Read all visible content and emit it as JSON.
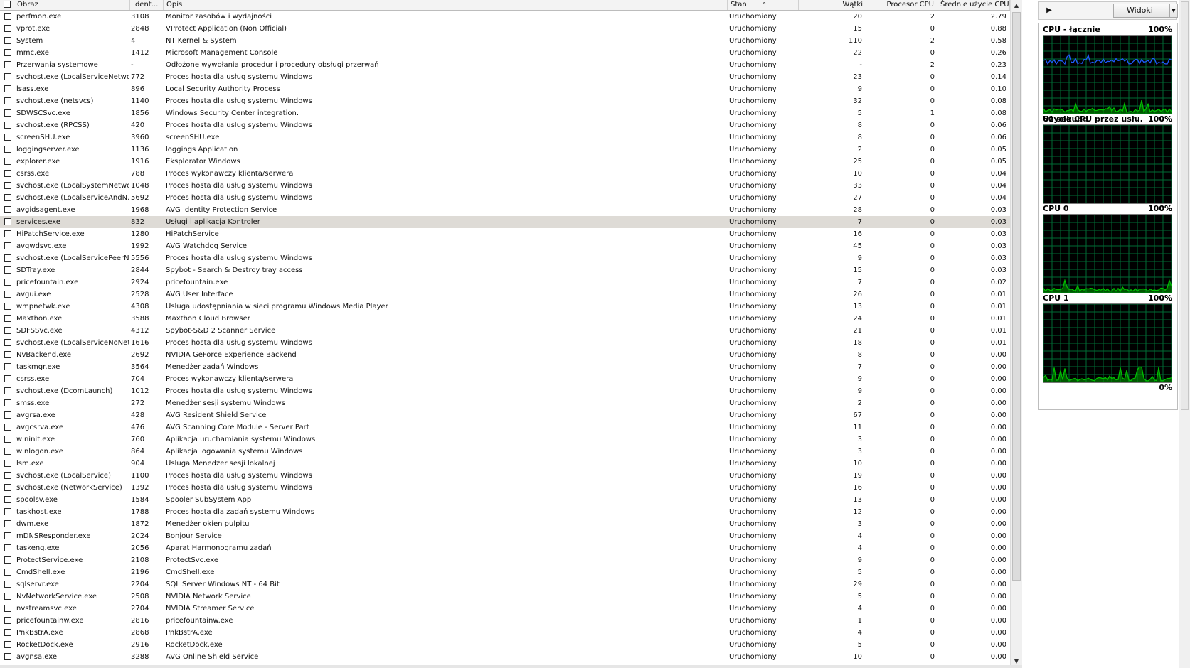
{
  "columns": {
    "name": "Obraz",
    "pid": "Ident...",
    "desc": "Opis",
    "stan": "Stan",
    "stan_sort": "^",
    "watki": "Wątki",
    "cpu": "Procesor CPU",
    "avg": "Średnie użycie CPU"
  },
  "selected_index": 17,
  "rows": [
    [
      "perfmon.exe",
      "3108",
      "Monitor zasobów i wydajności",
      "Uruchomiony",
      "20",
      "2",
      "2.79"
    ],
    [
      "vprot.exe",
      "2848",
      "VProtect Application (Non Official)",
      "Uruchomiony",
      "15",
      "0",
      "0.88"
    ],
    [
      "System",
      "4",
      "NT Kernel & System",
      "Uruchomiony",
      "110",
      "2",
      "0.58"
    ],
    [
      "mmc.exe",
      "1412",
      "Microsoft Management Console",
      "Uruchomiony",
      "22",
      "0",
      "0.26"
    ],
    [
      "Przerwania systemowe",
      "-",
      "Odłożone wywołania procedur i procedury obsługi przerwań",
      "Uruchomiony",
      "-",
      "2",
      "0.23"
    ],
    [
      "svchost.exe (LocalServiceNetwo...",
      "772",
      "Proces hosta dla usług systemu Windows",
      "Uruchomiony",
      "23",
      "0",
      "0.14"
    ],
    [
      "lsass.exe",
      "896",
      "Local Security Authority Process",
      "Uruchomiony",
      "9",
      "0",
      "0.10"
    ],
    [
      "svchost.exe (netsvcs)",
      "1140",
      "Proces hosta dla usług systemu Windows",
      "Uruchomiony",
      "32",
      "0",
      "0.08"
    ],
    [
      "SDWSCSvc.exe",
      "1856",
      "Windows Security Center integration.",
      "Uruchomiony",
      "5",
      "1",
      "0.08"
    ],
    [
      "svchost.exe (RPCSS)",
      "420",
      "Proces hosta dla usług systemu Windows",
      "Uruchomiony",
      "8",
      "0",
      "0.06"
    ],
    [
      "screenSHU.exe",
      "3960",
      "screenSHU.exe",
      "Uruchomiony",
      "8",
      "0",
      "0.06"
    ],
    [
      "loggingserver.exe",
      "1136",
      "loggings Application",
      "Uruchomiony",
      "2",
      "0",
      "0.05"
    ],
    [
      "explorer.exe",
      "1916",
      "Eksplorator Windows",
      "Uruchomiony",
      "25",
      "0",
      "0.05"
    ],
    [
      "csrss.exe",
      "788",
      "Proces wykonawczy klienta/serwera",
      "Uruchomiony",
      "10",
      "0",
      "0.04"
    ],
    [
      "svchost.exe (LocalSystemNetwo...",
      "1048",
      "Proces hosta dla usług systemu Windows",
      "Uruchomiony",
      "33",
      "0",
      "0.04"
    ],
    [
      "svchost.exe (LocalServiceAndN...",
      "5692",
      "Proces hosta dla usług systemu Windows",
      "Uruchomiony",
      "27",
      "0",
      "0.04"
    ],
    [
      "avgidsagent.exe",
      "1968",
      "AVG Identity Protection Service",
      "Uruchomiony",
      "28",
      "0",
      "0.03"
    ],
    [
      "services.exe",
      "832",
      "Usługi i aplikacja Kontroler",
      "Uruchomiony",
      "7",
      "0",
      "0.03"
    ],
    [
      "HiPatchService.exe",
      "1280",
      "HiPatchService",
      "Uruchomiony",
      "16",
      "0",
      "0.03"
    ],
    [
      "avgwdsvc.exe",
      "1992",
      "AVG Watchdog Service",
      "Uruchomiony",
      "45",
      "0",
      "0.03"
    ],
    [
      "svchost.exe (LocalServicePeerN...",
      "5556",
      "Proces hosta dla usług systemu Windows",
      "Uruchomiony",
      "9",
      "0",
      "0.03"
    ],
    [
      "SDTray.exe",
      "2844",
      "Spybot - Search & Destroy tray access",
      "Uruchomiony",
      "15",
      "0",
      "0.03"
    ],
    [
      "pricefountain.exe",
      "2924",
      "pricefountain.exe",
      "Uruchomiony",
      "7",
      "0",
      "0.02"
    ],
    [
      "avgui.exe",
      "2528",
      "AVG User Interface",
      "Uruchomiony",
      "26",
      "0",
      "0.01"
    ],
    [
      "wmpnetwk.exe",
      "4308",
      "Usługa udostępniania w sieci programu Windows Media Player",
      "Uruchomiony",
      "13",
      "0",
      "0.01"
    ],
    [
      "Maxthon.exe",
      "3588",
      "Maxthon Cloud Browser",
      "Uruchomiony",
      "24",
      "0",
      "0.01"
    ],
    [
      "SDFSSvc.exe",
      "4312",
      "Spybot-S&D 2 Scanner Service",
      "Uruchomiony",
      "21",
      "0",
      "0.01"
    ],
    [
      "svchost.exe (LocalServiceNoNet...",
      "1616",
      "Proces hosta dla usług systemu Windows",
      "Uruchomiony",
      "18",
      "0",
      "0.01"
    ],
    [
      "NvBackend.exe",
      "2692",
      "NVIDIA GeForce Experience Backend",
      "Uruchomiony",
      "8",
      "0",
      "0.00"
    ],
    [
      "taskmgr.exe",
      "3564",
      "Menedżer zadań Windows",
      "Uruchomiony",
      "7",
      "0",
      "0.00"
    ],
    [
      "csrss.exe",
      "704",
      "Proces wykonawczy klienta/serwera",
      "Uruchomiony",
      "9",
      "0",
      "0.00"
    ],
    [
      "svchost.exe (DcomLaunch)",
      "1012",
      "Proces hosta dla usług systemu Windows",
      "Uruchomiony",
      "9",
      "0",
      "0.00"
    ],
    [
      "smss.exe",
      "272",
      "Menedżer sesji systemu Windows",
      "Uruchomiony",
      "2",
      "0",
      "0.00"
    ],
    [
      "avgrsa.exe",
      "428",
      "AVG Resident Shield Service",
      "Uruchomiony",
      "67",
      "0",
      "0.00"
    ],
    [
      "avgcsrva.exe",
      "476",
      "AVG Scanning Core Module - Server Part",
      "Uruchomiony",
      "11",
      "0",
      "0.00"
    ],
    [
      "wininit.exe",
      "760",
      "Aplikacja uruchamiania systemu Windows",
      "Uruchomiony",
      "3",
      "0",
      "0.00"
    ],
    [
      "winlogon.exe",
      "864",
      "Aplikacja logowania systemu Windows",
      "Uruchomiony",
      "3",
      "0",
      "0.00"
    ],
    [
      "lsm.exe",
      "904",
      "Usługa Menedżer sesji lokalnej",
      "Uruchomiony",
      "10",
      "0",
      "0.00"
    ],
    [
      "svchost.exe (LocalService)",
      "1100",
      "Proces hosta dla usług systemu Windows",
      "Uruchomiony",
      "19",
      "0",
      "0.00"
    ],
    [
      "svchost.exe (NetworkService)",
      "1392",
      "Proces hosta dla usług systemu Windows",
      "Uruchomiony",
      "16",
      "0",
      "0.00"
    ],
    [
      "spoolsv.exe",
      "1584",
      "Spooler SubSystem App",
      "Uruchomiony",
      "13",
      "0",
      "0.00"
    ],
    [
      "taskhost.exe",
      "1788",
      "Proces hosta dla zadań systemu Windows",
      "Uruchomiony",
      "12",
      "0",
      "0.00"
    ],
    [
      "dwm.exe",
      "1872",
      "Menedżer okien pulpitu",
      "Uruchomiony",
      "3",
      "0",
      "0.00"
    ],
    [
      "mDNSResponder.exe",
      "2024",
      "Bonjour Service",
      "Uruchomiony",
      "4",
      "0",
      "0.00"
    ],
    [
      "taskeng.exe",
      "2056",
      "Aparat Harmonogramu zadań",
      "Uruchomiony",
      "4",
      "0",
      "0.00"
    ],
    [
      "ProtectService.exe",
      "2108",
      "ProtectSvc.exe",
      "Uruchomiony",
      "9",
      "0",
      "0.00"
    ],
    [
      "CmdShell.exe",
      "2196",
      "CmdShell.exe",
      "Uruchomiony",
      "5",
      "0",
      "0.00"
    ],
    [
      "sqlservr.exe",
      "2204",
      "SQL Server Windows NT - 64 Bit",
      "Uruchomiony",
      "29",
      "0",
      "0.00"
    ],
    [
      "NvNetworkService.exe",
      "2508",
      "NVIDIA Network Service",
      "Uruchomiony",
      "5",
      "0",
      "0.00"
    ],
    [
      "nvstreamsvc.exe",
      "2704",
      "NVIDIA Streamer Service",
      "Uruchomiony",
      "4",
      "0",
      "0.00"
    ],
    [
      "pricefountainw.exe",
      "2816",
      "pricefountainw.exe",
      "Uruchomiony",
      "1",
      "0",
      "0.00"
    ],
    [
      "PnkBstrA.exe",
      "2868",
      "PnkBstrA.exe",
      "Uruchomiony",
      "4",
      "0",
      "0.00"
    ],
    [
      "RocketDock.exe",
      "2916",
      "RocketDock.exe",
      "Uruchomiony",
      "5",
      "0",
      "0.00"
    ],
    [
      "avgnsa.exe",
      "3288",
      "AVG Online Shield Service",
      "Uruchomiony",
      "10",
      "0",
      "0.00"
    ]
  ],
  "panel": {
    "views_label": "Widoki",
    "graphs": [
      {
        "title": "CPU - łącznie",
        "max": "100%",
        "foot_left": "60 sekund",
        "min": "0%",
        "colors": [
          "#1f5cff",
          "#00c000"
        ]
      },
      {
        "title": "Użycie CPU przez usłu...",
        "max": "100%",
        "foot_left": "",
        "min": "0%",
        "colors": []
      },
      {
        "title": "CPU 0",
        "max": "100%",
        "foot_left": "",
        "min": "0%",
        "colors": [
          "#00c000"
        ]
      },
      {
        "title": "CPU 1",
        "max": "100%",
        "foot_left": "",
        "min": "0%",
        "colors": [
          "#00c000"
        ]
      }
    ]
  }
}
